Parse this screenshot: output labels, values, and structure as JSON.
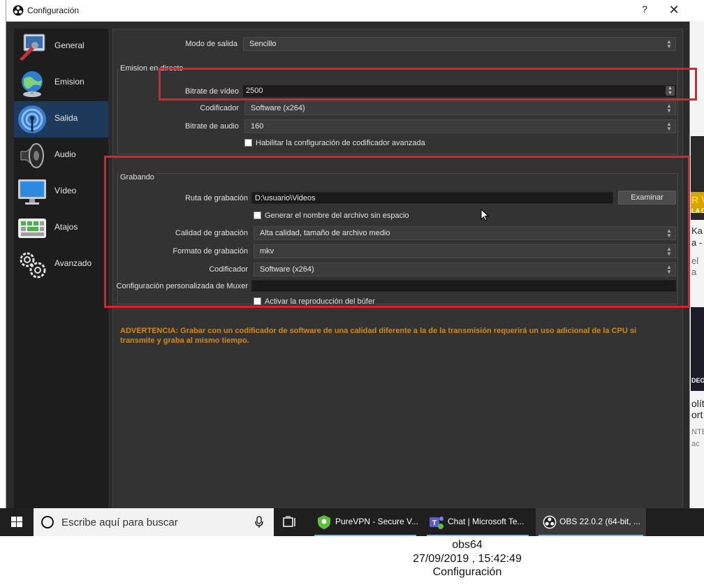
{
  "window": {
    "title": "Configuración",
    "help_label": "?",
    "close_label": "✕"
  },
  "sidebar": {
    "items": [
      {
        "label": "General",
        "icon": "general-settings-icon"
      },
      {
        "label": "Emision",
        "icon": "stream-globe-icon"
      },
      {
        "label": "Salida",
        "icon": "output-antenna-icon"
      },
      {
        "label": "Audio",
        "icon": "speaker-icon"
      },
      {
        "label": "Vídeo",
        "icon": "monitor-icon"
      },
      {
        "label": "Atajos",
        "icon": "keyboard-icon"
      },
      {
        "label": "Avanzado",
        "icon": "gears-icon"
      }
    ],
    "selected": "Salida"
  },
  "output": {
    "mode_label": "Modo de salida",
    "mode_value": "Sencillo",
    "streaming": {
      "title": "Emision en directo",
      "video_bitrate_label": "Bitrate de vídeo",
      "video_bitrate_value": "2500",
      "encoder_label": "Codificador",
      "encoder_value": "Software (x264)",
      "audio_bitrate_label": "Bitrate de audio",
      "audio_bitrate_value": "160",
      "advanced_checkbox_label": "Habilitar la configuración de codificador avanzada"
    },
    "recording": {
      "title": "Grabando",
      "path_label": "Ruta de grabación",
      "path_value": "D:\\usuario\\Videos",
      "browse_label": "Examinar",
      "nospace_checkbox_label": "Generar el nombre del archivo sin espacio",
      "quality_label": "Calidad de grabación",
      "quality_value": "Alta calidad, tamaño de archivo medio",
      "format_label": "Formato de grabación",
      "format_value": "mkv",
      "encoder_label": "Codificador",
      "encoder_value": "Software (x264)",
      "muxer_label": "Configuración personalizada de Muxer",
      "muxer_value": "",
      "replay_checkbox_label": "Activar la reproducción del búfer"
    },
    "warning": "ADVERTENCIA: Grabar con un codificador de software de una calidad diferente a la de la transmisión requerirá un uso adicional de la CPU si transmite y graba al mismo tiempo."
  },
  "taskbar": {
    "search_placeholder": "Escribe aquí para buscar",
    "items": [
      {
        "label": "PureVPN - Secure V...",
        "icon": "purevpn-icon"
      },
      {
        "label": "Chat | Microsoft Te...",
        "icon": "teams-icon"
      },
      {
        "label": "OBS 22.0.2 (64-bit, ...",
        "icon": "obs-icon"
      }
    ]
  },
  "caption": {
    "line1": "obs64",
    "line2": "27/09/2019 , 15:42:49",
    "line3": "Configuración"
  },
  "background_fragments": [
    "R V",
    "LA DE",
    "Ka",
    "a -",
    "el",
    "a",
    "DEO D",
    "olít",
    "ort",
    "NTE",
    "ac"
  ],
  "colors": {
    "highlight_box": "#e0202a",
    "warning_text": "#d4890c",
    "selected_nav": "#1e3a5a"
  }
}
